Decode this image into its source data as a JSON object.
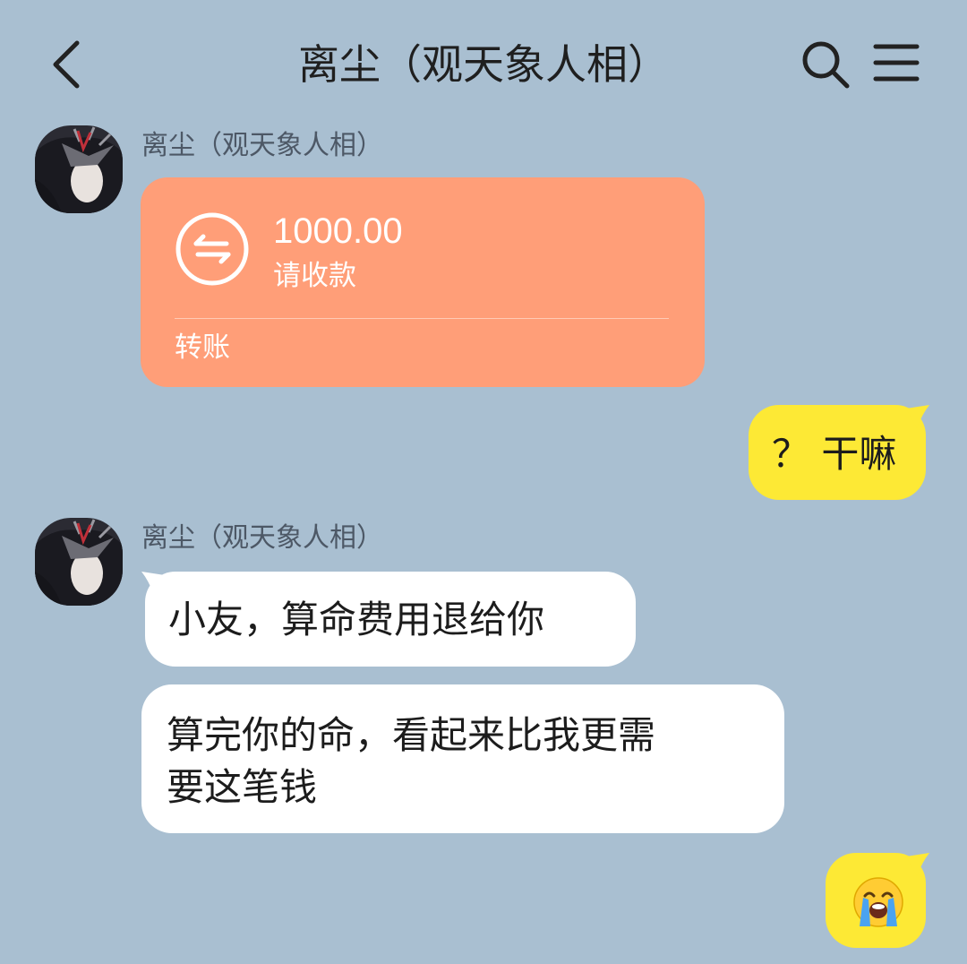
{
  "header": {
    "title": "离尘（观天象人相）",
    "back_icon": "chevron-left-icon",
    "search_icon": "search-icon",
    "menu_icon": "menu-icon"
  },
  "messages": [
    {
      "sender": "离尘（观天象人相）",
      "type": "transfer",
      "amount": "1000.00",
      "status": "请收款",
      "transfer_type": "转账",
      "color": "#ff9e78"
    },
    {
      "side": "right",
      "type": "text",
      "text": "？ 干嘛",
      "color": "#fde935"
    },
    {
      "sender": "离尘（观天象人相）",
      "type": "text",
      "text": "小友，算命费用退给你",
      "color": "#ffffff"
    },
    {
      "type": "text",
      "text_line1": "算完你的命，看起来比我更需",
      "text_line2": "要这笔钱",
      "color": "#ffffff"
    },
    {
      "side": "right",
      "type": "emoji",
      "emoji": "loudly-crying-face-icon",
      "color": "#fde935"
    }
  ],
  "theme": {
    "background": "#a9bfd1"
  }
}
